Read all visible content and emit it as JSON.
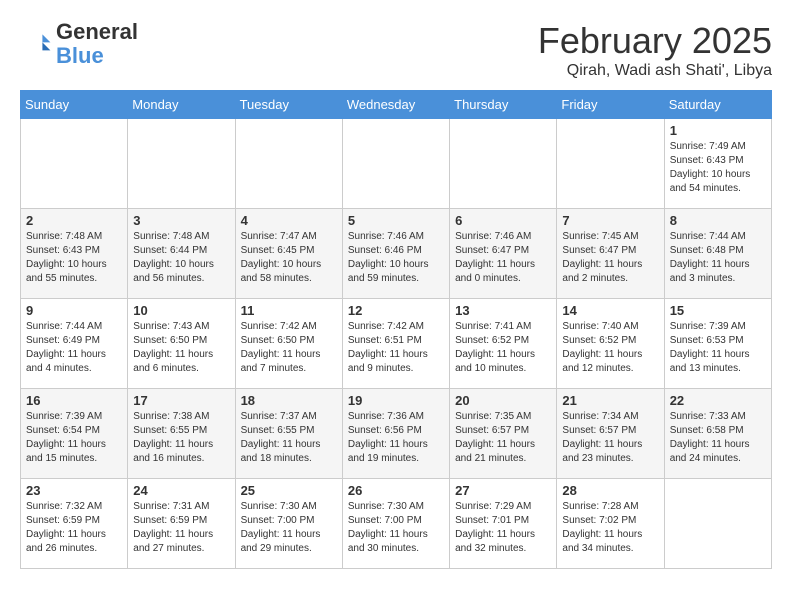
{
  "header": {
    "logo_general": "General",
    "logo_blue": "Blue",
    "month_title": "February 2025",
    "location": "Qirah, Wadi ash Shati', Libya"
  },
  "days_of_week": [
    "Sunday",
    "Monday",
    "Tuesday",
    "Wednesday",
    "Thursday",
    "Friday",
    "Saturday"
  ],
  "weeks": [
    {
      "days": [
        {
          "num": "",
          "info": ""
        },
        {
          "num": "",
          "info": ""
        },
        {
          "num": "",
          "info": ""
        },
        {
          "num": "",
          "info": ""
        },
        {
          "num": "",
          "info": ""
        },
        {
          "num": "",
          "info": ""
        },
        {
          "num": "1",
          "info": "Sunrise: 7:49 AM\nSunset: 6:43 PM\nDaylight: 10 hours\nand 54 minutes."
        }
      ]
    },
    {
      "days": [
        {
          "num": "2",
          "info": "Sunrise: 7:48 AM\nSunset: 6:43 PM\nDaylight: 10 hours\nand 55 minutes."
        },
        {
          "num": "3",
          "info": "Sunrise: 7:48 AM\nSunset: 6:44 PM\nDaylight: 10 hours\nand 56 minutes."
        },
        {
          "num": "4",
          "info": "Sunrise: 7:47 AM\nSunset: 6:45 PM\nDaylight: 10 hours\nand 58 minutes."
        },
        {
          "num": "5",
          "info": "Sunrise: 7:46 AM\nSunset: 6:46 PM\nDaylight: 10 hours\nand 59 minutes."
        },
        {
          "num": "6",
          "info": "Sunrise: 7:46 AM\nSunset: 6:47 PM\nDaylight: 11 hours\nand 0 minutes."
        },
        {
          "num": "7",
          "info": "Sunrise: 7:45 AM\nSunset: 6:47 PM\nDaylight: 11 hours\nand 2 minutes."
        },
        {
          "num": "8",
          "info": "Sunrise: 7:44 AM\nSunset: 6:48 PM\nDaylight: 11 hours\nand 3 minutes."
        }
      ]
    },
    {
      "days": [
        {
          "num": "9",
          "info": "Sunrise: 7:44 AM\nSunset: 6:49 PM\nDaylight: 11 hours\nand 4 minutes."
        },
        {
          "num": "10",
          "info": "Sunrise: 7:43 AM\nSunset: 6:50 PM\nDaylight: 11 hours\nand 6 minutes."
        },
        {
          "num": "11",
          "info": "Sunrise: 7:42 AM\nSunset: 6:50 PM\nDaylight: 11 hours\nand 7 minutes."
        },
        {
          "num": "12",
          "info": "Sunrise: 7:42 AM\nSunset: 6:51 PM\nDaylight: 11 hours\nand 9 minutes."
        },
        {
          "num": "13",
          "info": "Sunrise: 7:41 AM\nSunset: 6:52 PM\nDaylight: 11 hours\nand 10 minutes."
        },
        {
          "num": "14",
          "info": "Sunrise: 7:40 AM\nSunset: 6:52 PM\nDaylight: 11 hours\nand 12 minutes."
        },
        {
          "num": "15",
          "info": "Sunrise: 7:39 AM\nSunset: 6:53 PM\nDaylight: 11 hours\nand 13 minutes."
        }
      ]
    },
    {
      "days": [
        {
          "num": "16",
          "info": "Sunrise: 7:39 AM\nSunset: 6:54 PM\nDaylight: 11 hours\nand 15 minutes."
        },
        {
          "num": "17",
          "info": "Sunrise: 7:38 AM\nSunset: 6:55 PM\nDaylight: 11 hours\nand 16 minutes."
        },
        {
          "num": "18",
          "info": "Sunrise: 7:37 AM\nSunset: 6:55 PM\nDaylight: 11 hours\nand 18 minutes."
        },
        {
          "num": "19",
          "info": "Sunrise: 7:36 AM\nSunset: 6:56 PM\nDaylight: 11 hours\nand 19 minutes."
        },
        {
          "num": "20",
          "info": "Sunrise: 7:35 AM\nSunset: 6:57 PM\nDaylight: 11 hours\nand 21 minutes."
        },
        {
          "num": "21",
          "info": "Sunrise: 7:34 AM\nSunset: 6:57 PM\nDaylight: 11 hours\nand 23 minutes."
        },
        {
          "num": "22",
          "info": "Sunrise: 7:33 AM\nSunset: 6:58 PM\nDaylight: 11 hours\nand 24 minutes."
        }
      ]
    },
    {
      "days": [
        {
          "num": "23",
          "info": "Sunrise: 7:32 AM\nSunset: 6:59 PM\nDaylight: 11 hours\nand 26 minutes."
        },
        {
          "num": "24",
          "info": "Sunrise: 7:31 AM\nSunset: 6:59 PM\nDaylight: 11 hours\nand 27 minutes."
        },
        {
          "num": "25",
          "info": "Sunrise: 7:30 AM\nSunset: 7:00 PM\nDaylight: 11 hours\nand 29 minutes."
        },
        {
          "num": "26",
          "info": "Sunrise: 7:30 AM\nSunset: 7:00 PM\nDaylight: 11 hours\nand 30 minutes."
        },
        {
          "num": "27",
          "info": "Sunrise: 7:29 AM\nSunset: 7:01 PM\nDaylight: 11 hours\nand 32 minutes."
        },
        {
          "num": "28",
          "info": "Sunrise: 7:28 AM\nSunset: 7:02 PM\nDaylight: 11 hours\nand 34 minutes."
        },
        {
          "num": "",
          "info": ""
        }
      ]
    }
  ]
}
